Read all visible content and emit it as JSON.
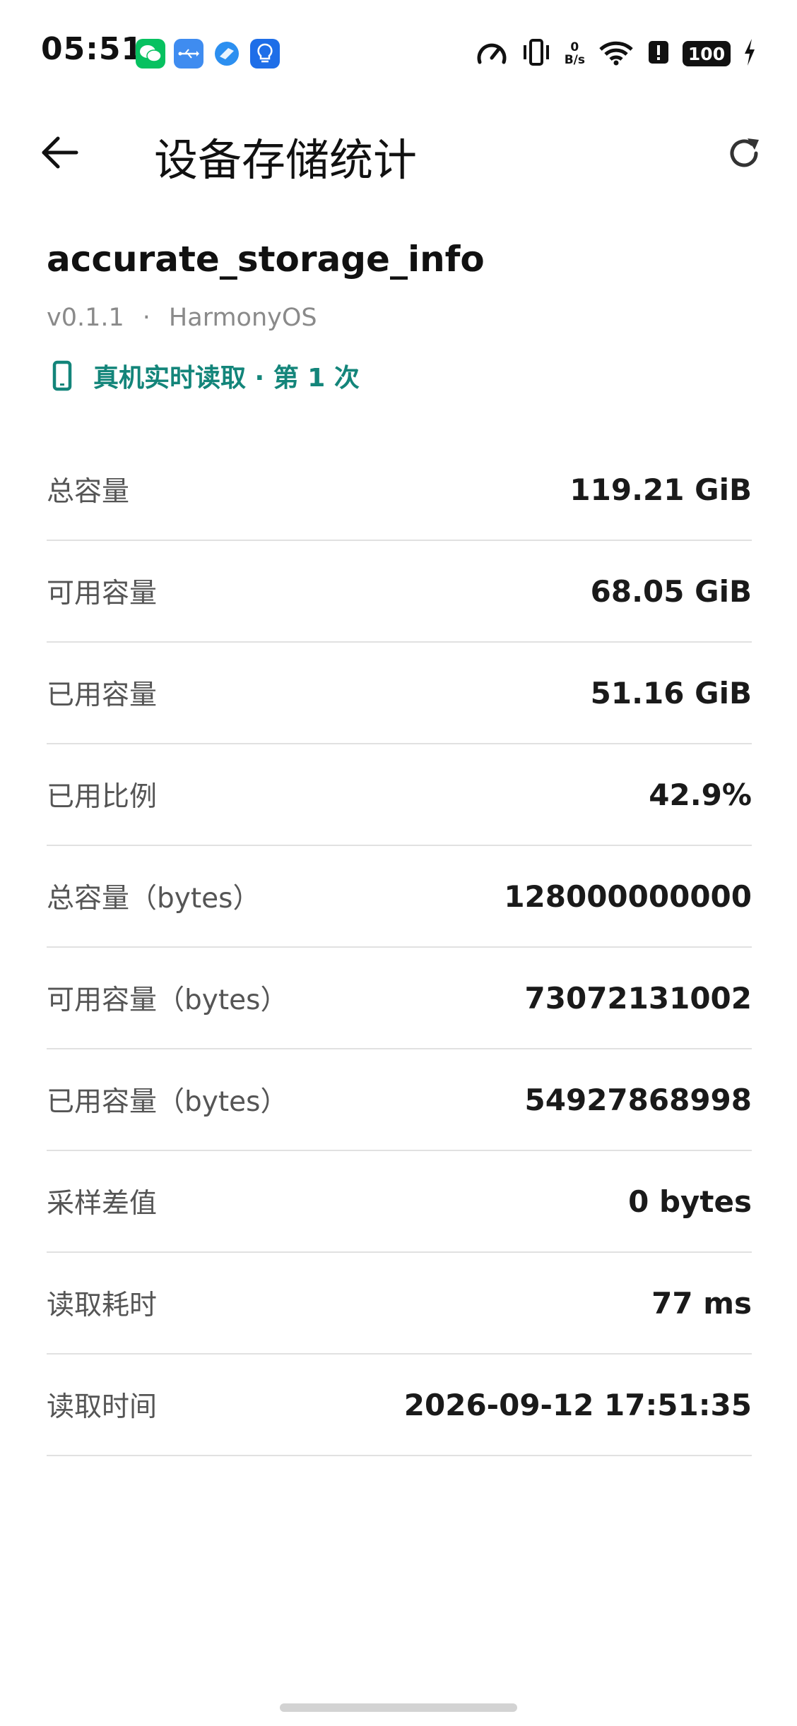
{
  "status_bar": {
    "time": "05:51",
    "net_speed_value": "0",
    "net_speed_unit": "B/s",
    "battery": "100",
    "icons": [
      "wechat-icon",
      "usb-icon",
      "browser-icon",
      "lightbulb-icon",
      "speedometer-icon",
      "vibrate-icon",
      "wifi-icon",
      "alert-icon",
      "battery-icon",
      "charging-icon"
    ]
  },
  "app_bar": {
    "title": "设备存储统计",
    "back_icon": "back-arrow-icon",
    "refresh_icon": "refresh-icon"
  },
  "header": {
    "package_name": "accurate_storage_info",
    "version": "v0.1.1",
    "separator": "·",
    "platform": "HarmonyOS",
    "source_text": "真机实时读取 · 第 1 次",
    "source_icon": "phone-icon",
    "accent_color": "#13857a"
  },
  "stats": [
    {
      "label": "总容量",
      "value": "119.21 GiB"
    },
    {
      "label": "可用容量",
      "value": "68.05 GiB"
    },
    {
      "label": "已用容量",
      "value": "51.16 GiB"
    },
    {
      "label": "已用比例",
      "value": "42.9%"
    },
    {
      "label": "总容量（bytes）",
      "value": "128000000000"
    },
    {
      "label": "可用容量（bytes）",
      "value": "73072131002"
    },
    {
      "label": "已用容量（bytes）",
      "value": "54927868998"
    },
    {
      "label": "采样差值",
      "value": "0 bytes"
    },
    {
      "label": "读取耗时",
      "value": "77 ms"
    },
    {
      "label": "读取时间",
      "value": "2026-09-12 17:51:35"
    }
  ]
}
